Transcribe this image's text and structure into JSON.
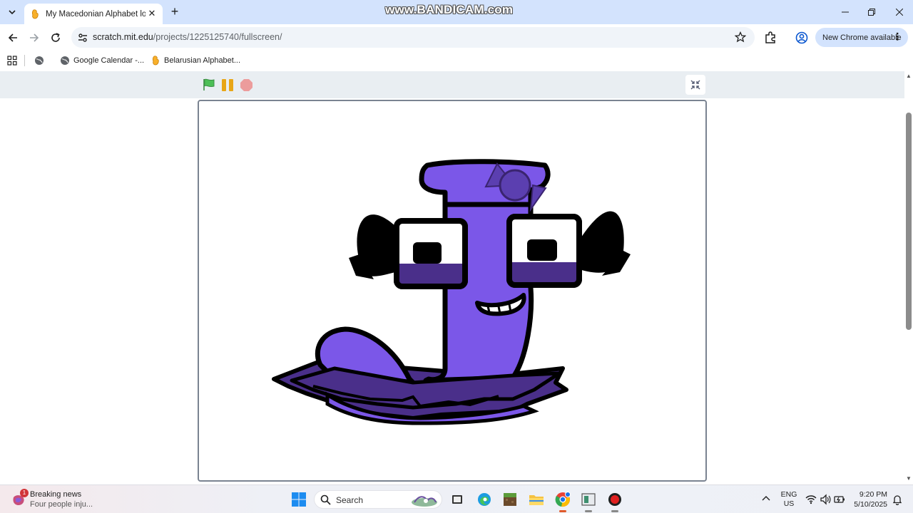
{
  "browser": {
    "tab": {
      "title": "My Macedonian Alphabet lore"
    },
    "watermark": "www.BANDICAM.com",
    "address": {
      "host": "scratch.mit.edu",
      "path": "/projects/1225125740/fullscreen/"
    },
    "update_chip": "New Chrome available",
    "bookmarks": [
      {
        "label": "Google Calendar -..."
      },
      {
        "label": "Belarusian Alphabet..."
      }
    ]
  },
  "scratch": {
    "controls": [
      "green-flag",
      "pause",
      "stop"
    ],
    "stage": {
      "character": "purple letter Ј with bow, horns and glasses"
    }
  },
  "taskbar": {
    "news": {
      "badge": "1",
      "title": "Breaking news",
      "subtitle": "Four people inju..."
    },
    "search_label": "Search",
    "lang": {
      "line1": "ENG",
      "line2": "US"
    },
    "clock": {
      "time": "9:20 PM",
      "date": "5/10/2025"
    }
  },
  "colors": {
    "tab_strip": "#d3e3fd",
    "player_bar": "#e9eef2",
    "letter_purple": "#7b57e8",
    "letter_dark_purple": "#4a2f8a",
    "flag_green": "#4cbf56",
    "pause_yellow": "#e8a617",
    "stop_red": "#ec9c9c"
  }
}
